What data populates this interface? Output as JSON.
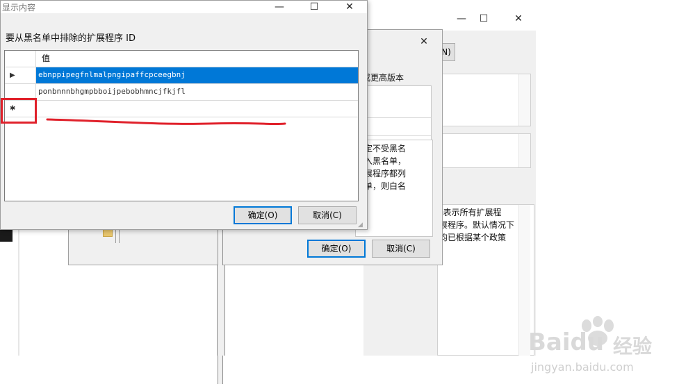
{
  "back_window": {
    "minimize_glyph": "—",
    "maximize_glyph": "☐",
    "close_glyph": "✕",
    "button_fragment": "N)",
    "desc_fragments": [
      "\"表示所有扩展程",
      "展程序。默认情况下",
      "均已根据某个政策"
    ]
  },
  "middle_window": {
    "close_glyph": "✕",
    "text_fragment_top": "或更高版本",
    "text_fragments": [
      "定不受黑名",
      "入黑名单，",
      "展程序都列",
      "单，则白名"
    ],
    "ok_label": "确定(O)",
    "cancel_label": "取消(C)"
  },
  "dialog": {
    "title": "显示内容",
    "minimize_glyph": "—",
    "maximize_glyph": "☐",
    "close_glyph": "✕",
    "heading": "要从黑名单中排除的扩展程序 ID",
    "column_header": "值",
    "rows": [
      {
        "marker": "▶",
        "value": "ebnppipegfnlmalpngipaffcpceegbnj"
      },
      {
        "marker": "",
        "value": "ponbnnnbhgmpbboijpebobhmncjfkjfl"
      },
      {
        "marker": "✱",
        "value": ""
      }
    ],
    "ok_label": "确定(O)",
    "cancel_label": "取消(C)"
  },
  "watermark": {
    "brand": "Bai",
    "brand_end": "du",
    "cn": "经验",
    "url": "jingyan.baidu.com"
  },
  "colors": {
    "selection": "#0078d7",
    "annotation": "#e0212b",
    "dialog_bg": "#f0f0f0"
  }
}
